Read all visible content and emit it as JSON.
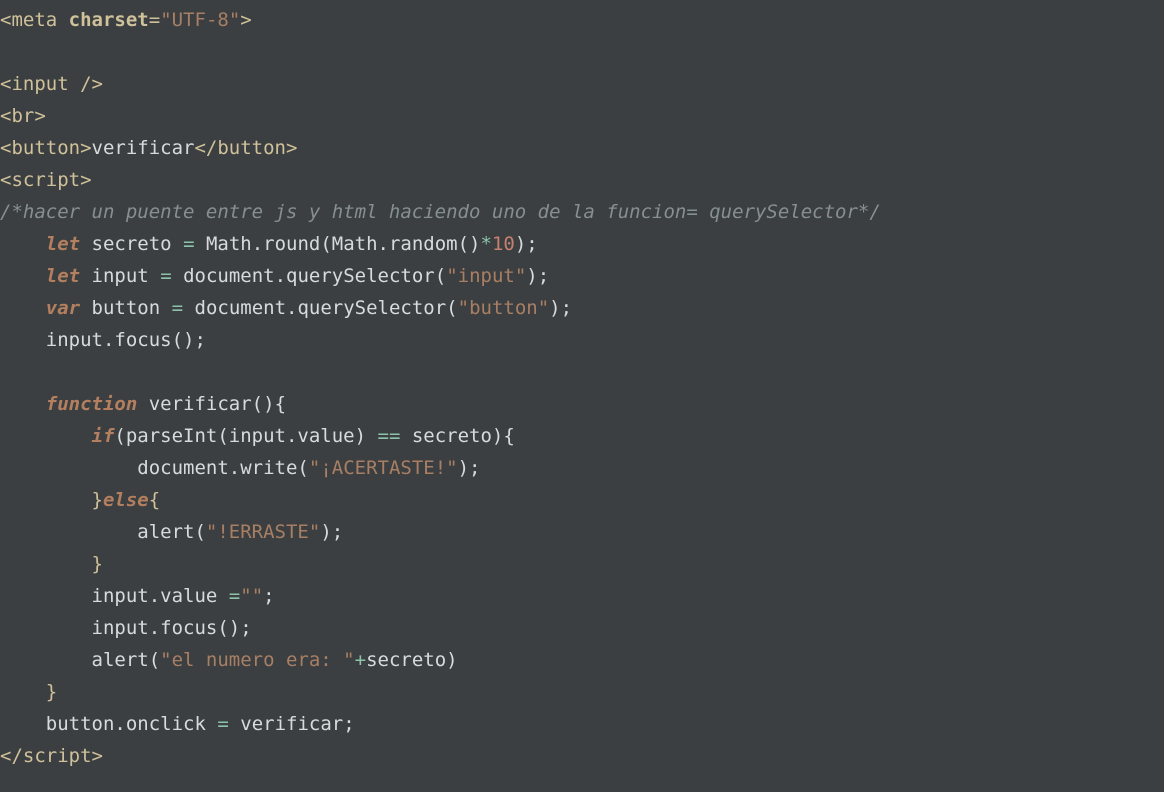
{
  "code": {
    "l1": {
      "meta_open": "<meta",
      "sp": " ",
      "charset": "charset",
      "eq": "=",
      "val": "\"UTF-8\"",
      "close": ">"
    },
    "l2": "",
    "l3": {
      "text": "<input />"
    },
    "l4": {
      "text": "<br>"
    },
    "l5": {
      "open": "<button>",
      "body": "verificar",
      "close": "</button>"
    },
    "l6": {
      "text": "<script>"
    },
    "l7": {
      "comment": "/*hacer un puente entre js y html haciendo uno de la funcion= querySelector*/"
    },
    "l8": {
      "indent": "    ",
      "kw": "let",
      "sp": " ",
      "id": "secreto ",
      "eq": "=",
      "rest1": " Math.round(Math.random()",
      "star": "*",
      "num": "10",
      "rest2": ");"
    },
    "l9": {
      "indent": "    ",
      "kw": "let",
      "sp": " ",
      "id": "input ",
      "eq": "=",
      "rest1": " document.querySelector(",
      "str": "\"input\"",
      "rest2": ");"
    },
    "l10": {
      "indent": "    ",
      "kw": "var",
      "sp": " ",
      "id": "button ",
      "eq": "=",
      "rest1": " document.querySelector(",
      "str": "\"button\"",
      "rest2": ");"
    },
    "l11": {
      "indent": "    ",
      "text": "input.focus();"
    },
    "l12": "",
    "l13": {
      "indent": "    ",
      "kw": "function",
      "sp": " ",
      "name": "verificar(){"
    },
    "l14": {
      "indent": "        ",
      "kw": "if",
      "rest1": "(parseInt(input.value) ",
      "op": "==",
      "rest2": " secreto){"
    },
    "l15": {
      "indent": "            ",
      "a": "document.write(",
      "s": "\"¡ACERTASTE!\"",
      "b": ");"
    },
    "l16": {
      "indent": "        ",
      "brace": "}",
      "kw": "else",
      "brace2": "{"
    },
    "l17": {
      "indent": "            ",
      "a": "alert(",
      "s": "\"!ERRASTE\"",
      "b": ");"
    },
    "l18": {
      "indent": "        ",
      "brace": "}"
    },
    "l19": {
      "indent": "        ",
      "a": "input.value ",
      "eq": "=",
      "s": "\"\"",
      "b": ";"
    },
    "l20": {
      "indent": "        ",
      "text": "input.focus();"
    },
    "l21": {
      "indent": "        ",
      "a": "alert(",
      "s": "\"el numero era: \"",
      "plus": "+",
      "b": "secreto)"
    },
    "l22": {
      "indent": "    ",
      "brace": "}"
    },
    "l23": {
      "indent": "    ",
      "a": "button.onclick ",
      "eq": "=",
      "b": " verificar;"
    },
    "l24": {
      "text": "</script>"
    }
  }
}
